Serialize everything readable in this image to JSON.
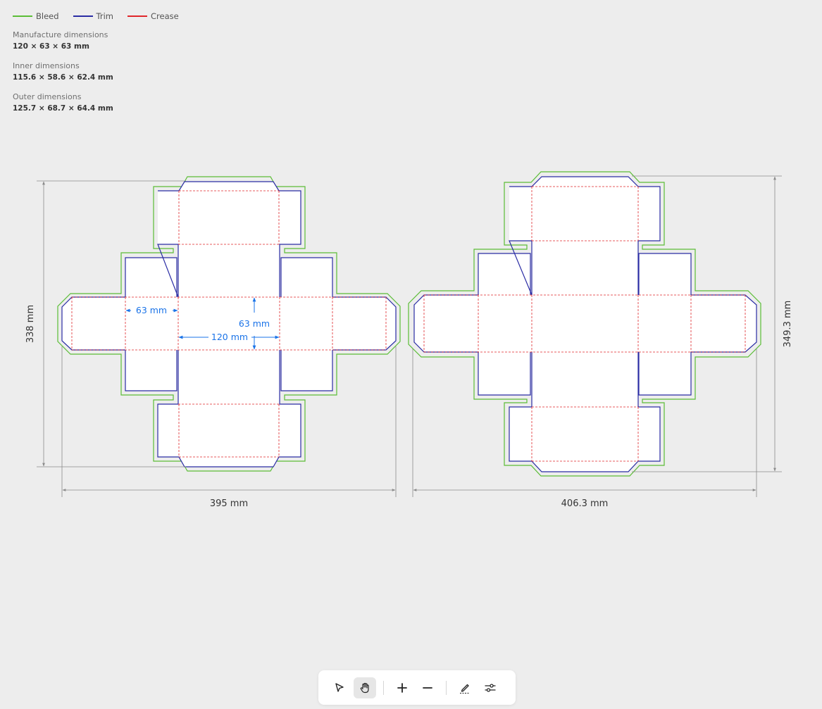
{
  "legend": [
    {
      "label": "Bleed",
      "color": "#5bbd36"
    },
    {
      "label": "Trim",
      "color": "#2a2ca4"
    },
    {
      "label": "Crease",
      "color": "#e0262a"
    }
  ],
  "specs": [
    {
      "label": "Manufacture dimensions",
      "value": "120 × 63 × 63 mm"
    },
    {
      "label": "Inner dimensions",
      "value": "115.6 × 58.6 × 62.4 mm"
    },
    {
      "label": "Outer dimensions",
      "value": "125.7 × 68.7 × 64.4 mm"
    }
  ],
  "dielines": {
    "left": {
      "width_label": "395 mm",
      "height_label": "338 mm",
      "callouts": {
        "side_width": "63 mm",
        "depth": "63 mm",
        "length": "120 mm"
      }
    },
    "right": {
      "width_label": "406.3 mm",
      "height_label": "349.3 mm"
    }
  },
  "colors": {
    "bleed": "#5bbd36",
    "trim": "#2a2ca4",
    "crease": "#e0262a",
    "dimension": "#8a8a8a",
    "callout": "#1a73e8",
    "background": "#ededed"
  },
  "toolbar": {
    "tools": [
      {
        "name": "select-tool",
        "icon": "pointer-icon",
        "active": false
      },
      {
        "name": "pan-tool",
        "icon": "hand-icon",
        "active": true
      },
      {
        "name": "zoom-in",
        "icon": "plus-icon",
        "active": false
      },
      {
        "name": "zoom-out",
        "icon": "minus-icon",
        "active": false
      },
      {
        "name": "annotate-tool",
        "icon": "pen-icon",
        "active": false
      },
      {
        "name": "settings-tool",
        "icon": "sliders-icon",
        "active": false
      }
    ]
  }
}
